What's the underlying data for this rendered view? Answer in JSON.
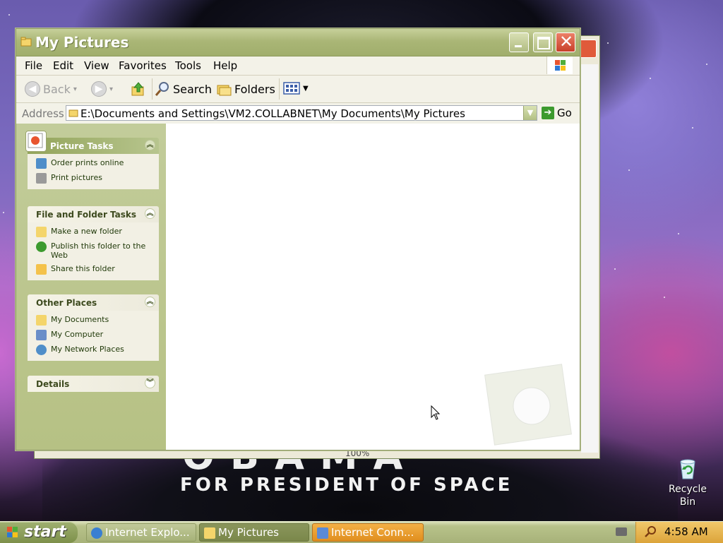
{
  "window": {
    "title": "My Pictures",
    "menu": [
      "File",
      "Edit",
      "View",
      "Favorites",
      "Tools",
      "Help"
    ],
    "toolbar": {
      "back_label": "Back",
      "search_label": "Search",
      "folders_label": "Folders"
    },
    "address": {
      "label": "Address",
      "value": "E:\\Documents and Settings\\VM2.COLLABNET\\My Documents\\My Pictures",
      "go_label": "Go"
    }
  },
  "left_pane": {
    "picture_tasks": {
      "title": "Picture Tasks",
      "items": [
        "Order prints online",
        "Print pictures"
      ]
    },
    "file_folder_tasks": {
      "title": "File and Folder Tasks",
      "items": [
        "Make a new folder",
        "Publish this folder to the Web",
        "Share this folder"
      ]
    },
    "other_places": {
      "title": "Other Places",
      "items": [
        "My Documents",
        "My Computer",
        "My Network Places"
      ]
    },
    "details": {
      "title": "Details"
    }
  },
  "background_window": {
    "status_zoom": "100%"
  },
  "desktop": {
    "wallpaper_text": "FOR PRESIDENT OF SPACE",
    "wallpaper_big": "OBAMA",
    "recycle_bin_label": "Recycle Bin"
  },
  "taskbar": {
    "start_label": "start",
    "tasks": [
      "Internet Explo...",
      "My Pictures",
      "Internet Conn..."
    ],
    "clock": "4:58 AM"
  },
  "colors": {
    "title_green": "#a0ae6c",
    "pane_green": "#b6c184",
    "tray_orange": "#dca43a",
    "active_task_orange": "#e08e1e"
  }
}
